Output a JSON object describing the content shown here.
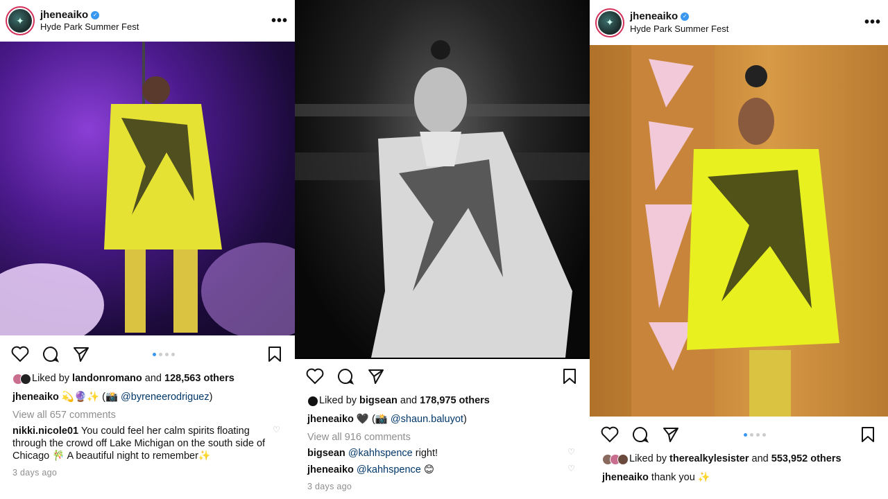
{
  "posts": [
    {
      "username": "jheneaiko",
      "location": "Hyde Park Summer Fest",
      "liked_by": "landonromano",
      "others": "128,563 others",
      "caption_user": "jheneaiko",
      "caption_text": "💫🔮✨ (📸",
      "caption_mention": "@byreneerodriguez",
      "caption_end": ")",
      "view_all": "View all 657 comments",
      "comments": [
        {
          "user": "nikki.nicole01",
          "mention": "",
          "text": "You could feel her calm spirits floating through the crowd off Lake Michigan on the south side of Chicago 🎋 A beautiful night to remember✨"
        }
      ],
      "time": "3 days ago"
    },
    {
      "username": "jheneaiko",
      "location": "",
      "liked_by": "bigsean",
      "others": "178,975 others",
      "caption_user": "jheneaiko",
      "caption_text": "🖤 (📸",
      "caption_mention": "@shaun.baluyot",
      "caption_end": ")",
      "view_all": "View all 916 comments",
      "comments": [
        {
          "user": "bigsean",
          "mention": "@kahhspence",
          "text": "right!"
        },
        {
          "user": "jheneaiko",
          "mention": "@kahhspence",
          "text": "😊"
        }
      ],
      "time": "3 days ago"
    },
    {
      "username": "jheneaiko",
      "location": "Hyde Park Summer Fest",
      "liked_by": "therealkylesister",
      "others": "553,952 others",
      "caption_user": "jheneaiko",
      "caption_text": "thank you ✨"
    }
  ],
  "labels": {
    "liked_by": "Liked by",
    "and": "and",
    "more": "•••"
  },
  "colors": {
    "verified": "#3897f0",
    "mention": "#00376b",
    "muted": "#8e8e8e",
    "avatar_ring": "#d3305a"
  }
}
